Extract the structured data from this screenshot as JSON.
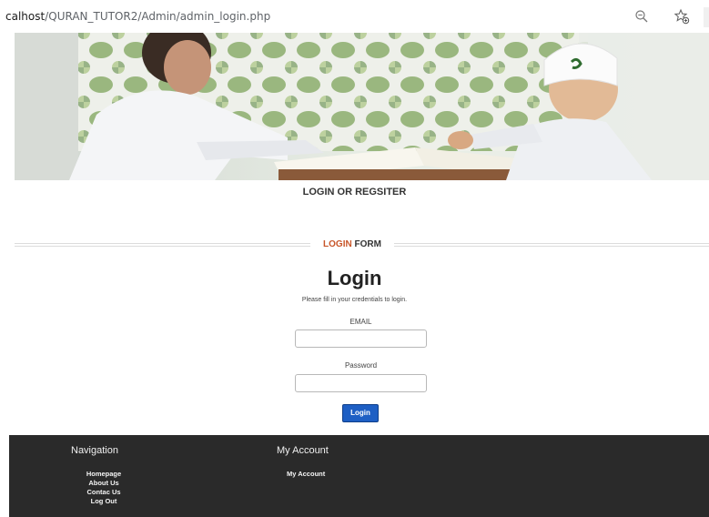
{
  "browser": {
    "url_host": "calhost",
    "url_path": "/QURAN_TUTOR2/Admin/admin_login.php"
  },
  "page": {
    "section_title": "LOGIN OR REGSITER",
    "form_legend_accent": "LOGIN",
    "form_legend_rest": " FORM",
    "heading": "Login",
    "subtitle": "Please fill in your credentials to login.",
    "email_label": "EMAIL",
    "email_value": "",
    "password_label": "Password",
    "password_value": "",
    "login_button": "Login"
  },
  "footer": {
    "navigation_heading": "Navigation",
    "navigation_items": [
      "Homepage",
      "About Us",
      "Contac Us",
      "Log Out"
    ],
    "account_heading": "My Account",
    "account_items": [
      "My Account"
    ]
  },
  "colors": {
    "accent": "#c8562a",
    "button": "#1e5fc4",
    "footer_bg": "#2a2a2a"
  },
  "icons": {
    "zoom": "zoom-out-icon",
    "favorite": "add-favorite-icon"
  }
}
